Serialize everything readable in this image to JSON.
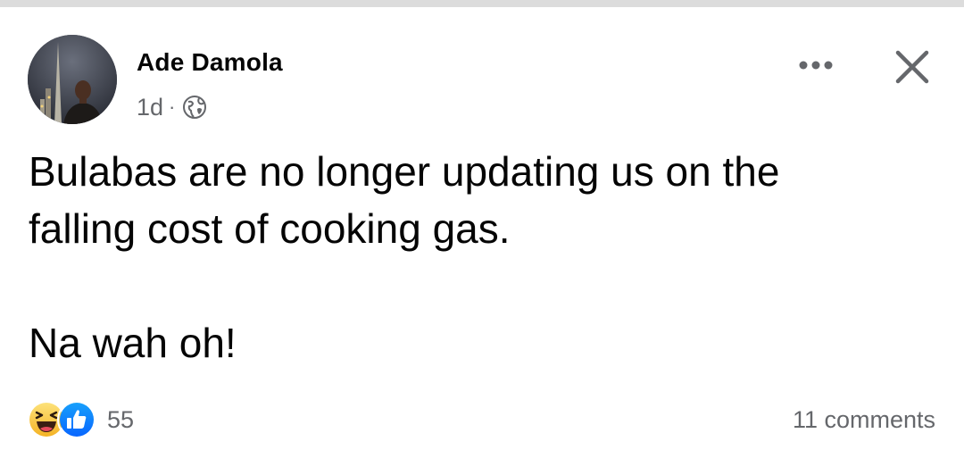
{
  "post": {
    "author": "Ade Damola",
    "time": "1d",
    "separator": "·",
    "privacy_icon": "globe-icon",
    "text_line1": "Bulabas are no longer updating us on the",
    "text_line2": "falling cost of cooking gas.",
    "text_line3": "Na wah oh!",
    "reaction_icons": [
      "haha-icon",
      "like-icon"
    ],
    "reaction_count": "55",
    "comments": "11 comments"
  },
  "header": {
    "more_icon": "more-options-icon",
    "close_icon": "close-icon"
  },
  "colors": {
    "text": "#050505",
    "secondary": "#65676b",
    "like_blue": "#1877f2",
    "haha_yellow": "#f7b928"
  }
}
